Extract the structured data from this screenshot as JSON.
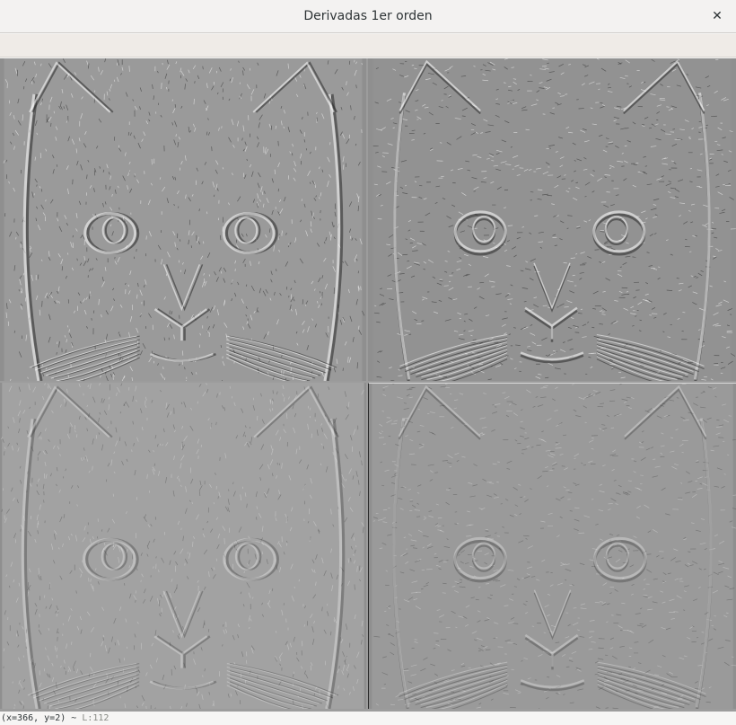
{
  "window": {
    "title": "Derivadas 1er orden",
    "close_glyph": "✕"
  },
  "panels": [
    {
      "name": "derivative-x",
      "tone": "#9a9a9a",
      "emboss": "x",
      "contrast": 1.0
    },
    {
      "name": "derivative-y",
      "tone": "#929292",
      "emboss": "y",
      "contrast": 1.0
    },
    {
      "name": "derivative-x-scaled",
      "tone": "#a2a2a2",
      "emboss": "x",
      "contrast": 0.55
    },
    {
      "name": "derivative-y-scaled",
      "tone": "#9a9a9a",
      "emboss": "y",
      "contrast": 0.55
    }
  ],
  "status": {
    "coords": "(x=366, y=2) ~ ",
    "luma": "L:112"
  }
}
